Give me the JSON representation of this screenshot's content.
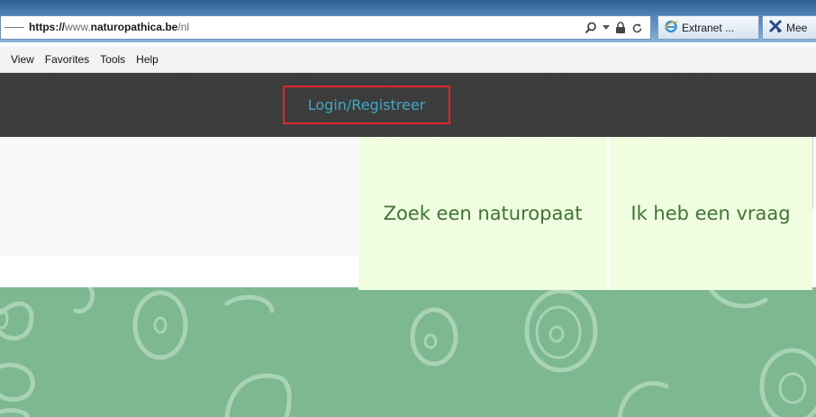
{
  "browser": {
    "url": {
      "scheme": "https://",
      "prefix": "www.",
      "domain": "naturopathica.be",
      "path": "/nl"
    },
    "tabs": [
      {
        "label": "Extranet ..."
      },
      {
        "label": "Mee"
      }
    ],
    "menu": [
      "View",
      "Favorites",
      "Tools",
      "Help"
    ]
  },
  "header": {
    "login_label": "Login/Registreer",
    "highlight_color": "#e0242b",
    "link_color": "#41a8c4"
  },
  "nav": {
    "items": [
      {
        "label": "Zoek een naturopaat"
      },
      {
        "label": "Ik heb een vraag"
      }
    ],
    "text_color": "#3e7535",
    "box_color": "#f0fde0"
  },
  "banner": {
    "color": "#7db891"
  }
}
